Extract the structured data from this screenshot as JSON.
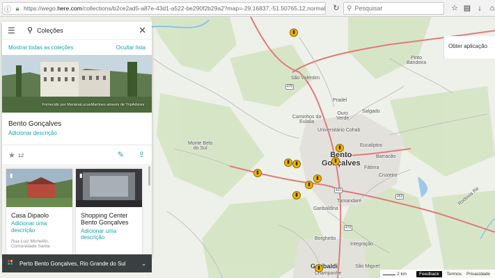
{
  "browser": {
    "url_prefix": "https://wego.",
    "url_domain": "here.com",
    "url_rest": "/collections/b2ce2ad5-a87e-43d1-a522-be290f2b29a2?map=-29.16837,-51.50765,12,normal",
    "search_placeholder": "Pesquisar"
  },
  "map": {
    "get_app_label": "Obter aplicação",
    "places": {
      "sao_valentim": "São Valentim",
      "pradel": "Pradel",
      "salgado": "Salgado",
      "caminhos": "Caminhos da\nEulalia",
      "ouro_verde": "Ouro\nVerde",
      "cohab": "Universitário Cohab",
      "monte_belo": "Monte Belo\ndo Sul",
      "eucaliptos": "Eucaliptos",
      "barracao": "Barracão",
      "bento": "Bento\nGonçalves",
      "fatima": "Fátima",
      "cruzeiro": "Cruzeiro",
      "tamandare": "Tamandaré",
      "garibaldina": "Garibaldina",
      "borghetto": "Borghetto",
      "integracao": "Integração",
      "sao_miguel": "São Miguel",
      "garibaldi": "Garibaldi",
      "champanhe": "Champanhe",
      "pinto_bandeira": "Pinto\nBandeira",
      "rodovia": "Rodovia Re"
    },
    "road_labels": [
      "470",
      "431",
      "453",
      "470"
    ],
    "bottom": {
      "scale": "2 km",
      "feedback": "Feedback",
      "terms": "Termos",
      "privacy": "Privacidade"
    }
  },
  "sidebar": {
    "title": "Coleções",
    "show_all": "Mostrar todas as coleções",
    "hide_list": "Ocultar lista",
    "hero_credit": "Fornecido por MarianaLucasMartines através de TripAdvisor",
    "place_title": "Bento Gonçalves",
    "add_description": "Adicionar descrição",
    "star_count": "12",
    "cards": [
      {
        "title": "Casa Dipaolo",
        "desc": "Adicionar uma descrição",
        "address": "Rua Luiz Michellin, Comunidade Santa"
      },
      {
        "title": "Shopping Center Bento Gonçalves",
        "desc": "Adicionar uma descrição",
        "address": ""
      }
    ],
    "nearby": "Perto Bento Gonçalves, Rio Grande do Sul"
  },
  "icons": [
    "lock-icon",
    "reload-icon",
    "search-icon",
    "star-icon",
    "bookmark-icon",
    "download-icon",
    "home-icon",
    "menu-icon",
    "close-icon",
    "edit-icon",
    "share-icon",
    "chevron-down-icon"
  ],
  "colors": {
    "accent": "#1aa3a8",
    "poi": "#f0b400",
    "road": "#e07070"
  }
}
